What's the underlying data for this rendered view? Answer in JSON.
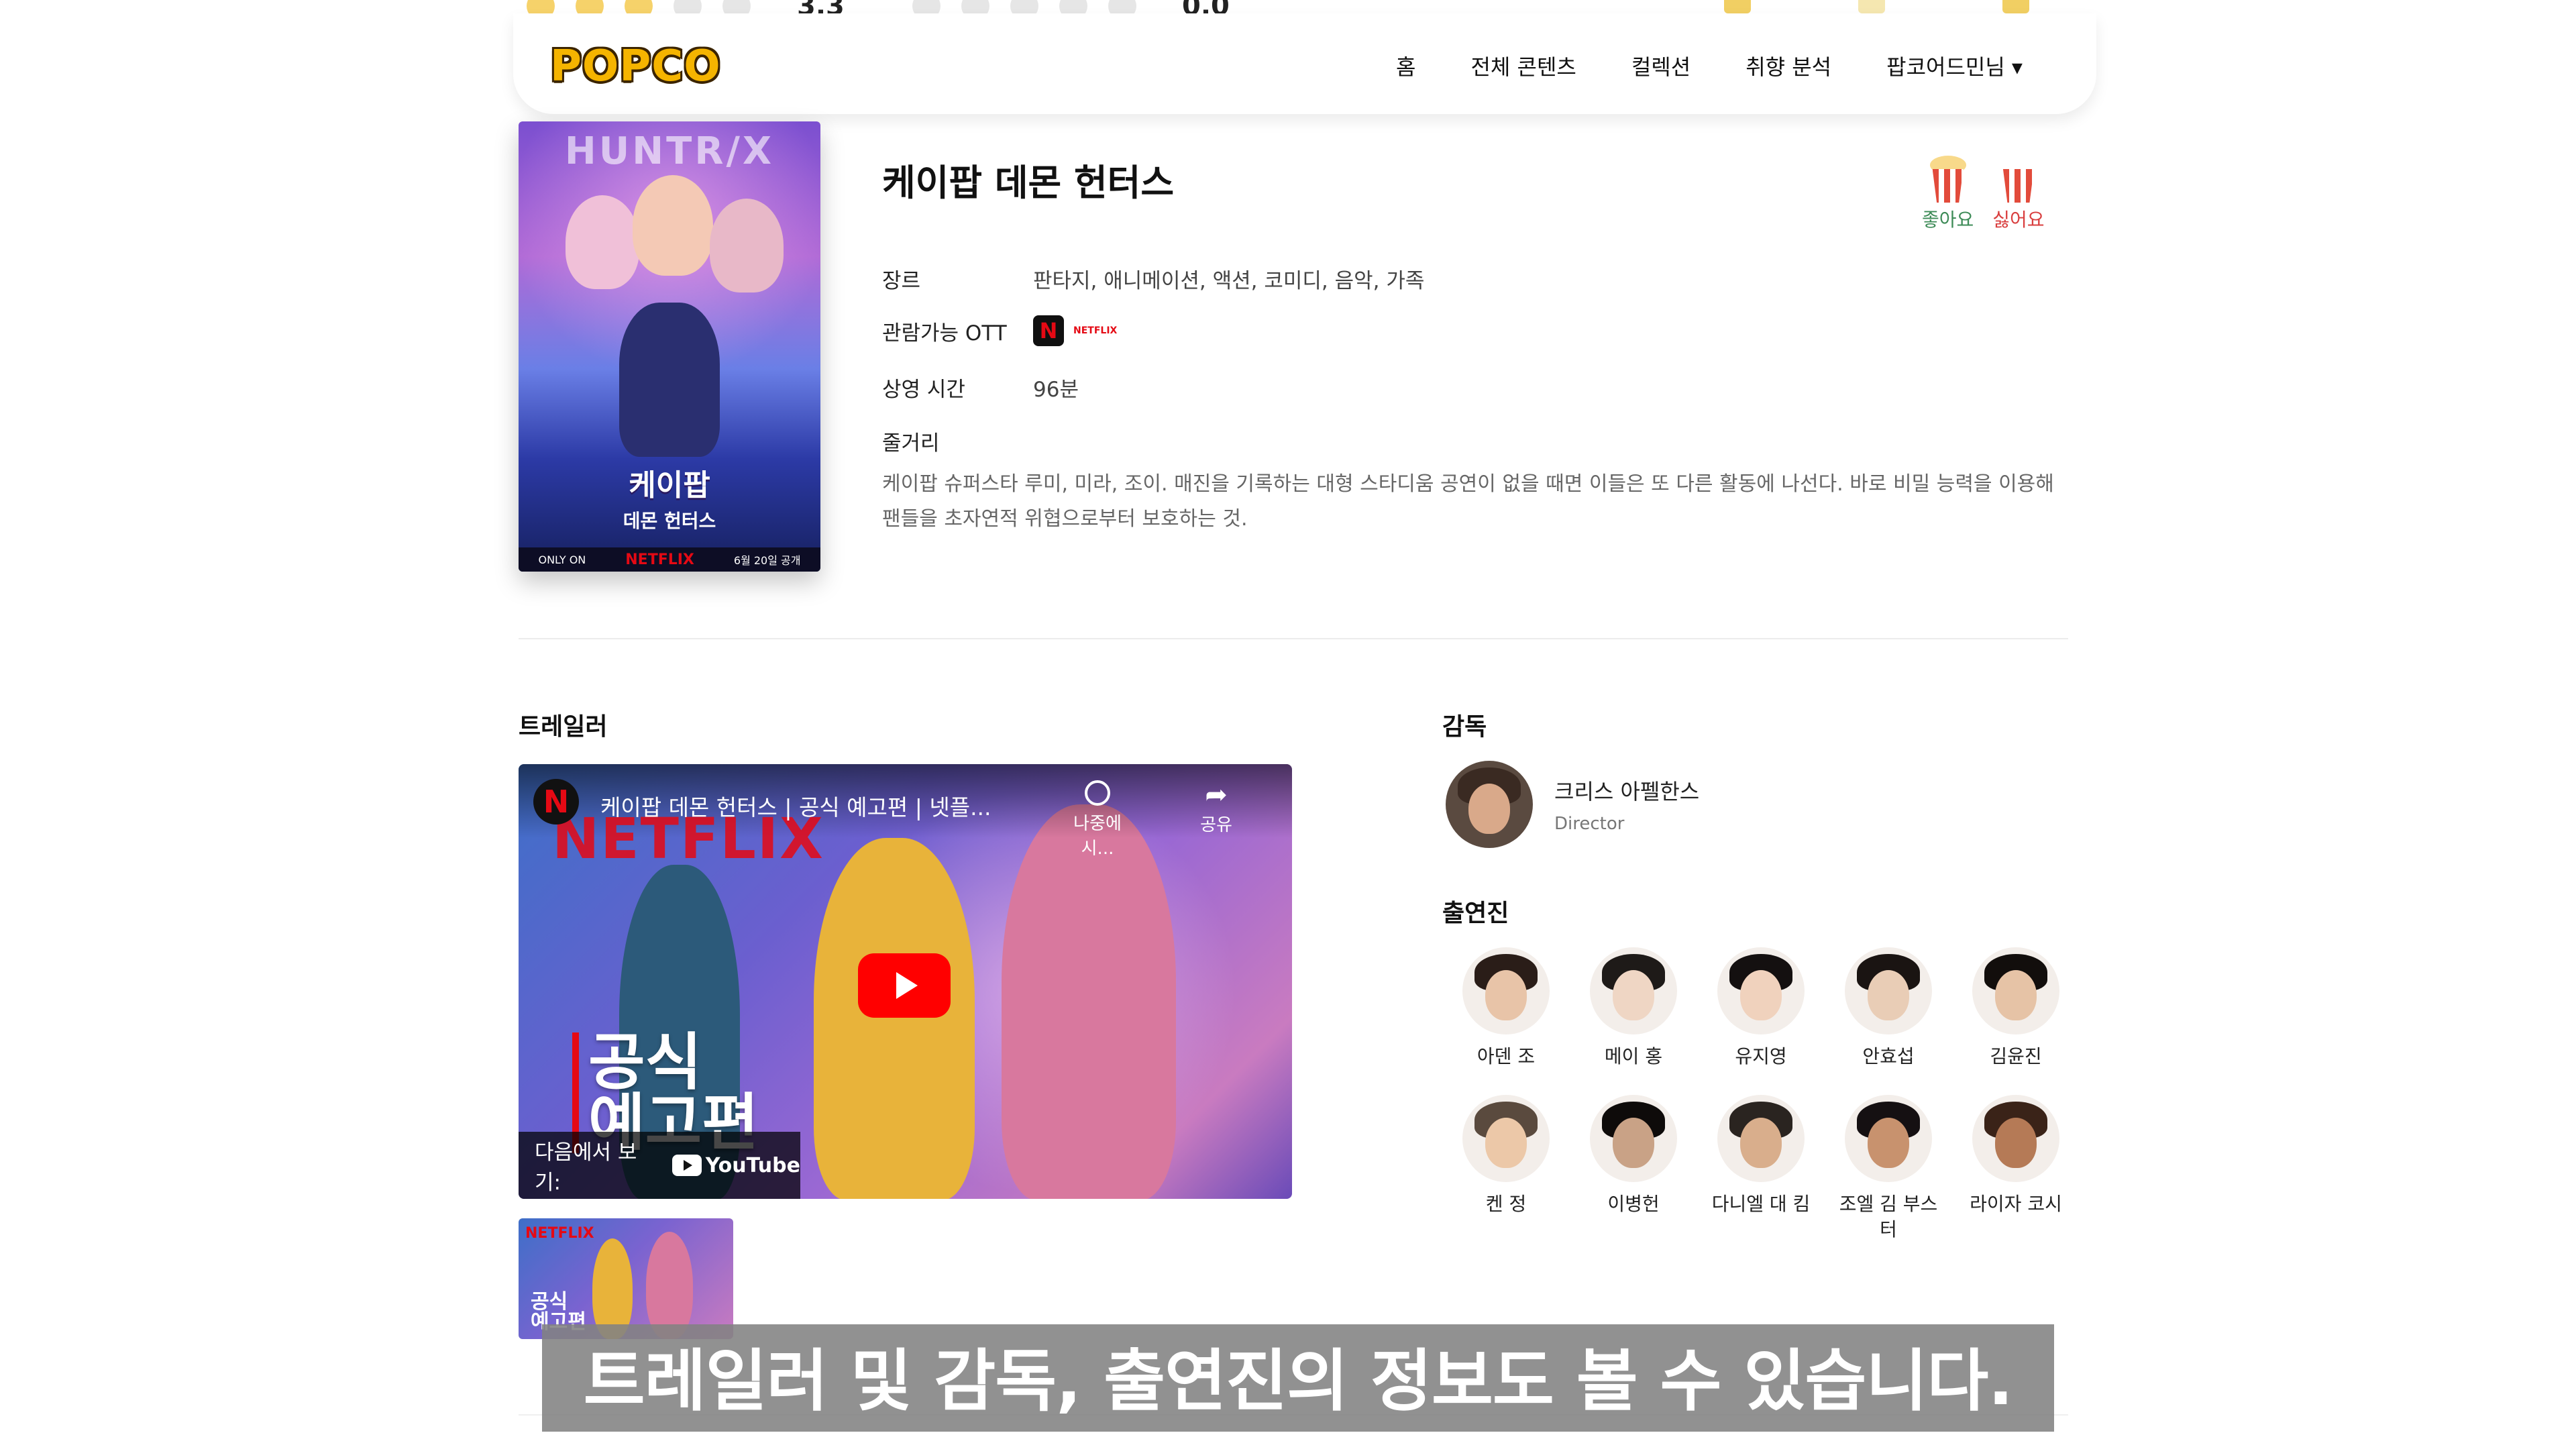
{
  "rating_strip": {
    "left_score": "3.3",
    "left_stars_filled": 3,
    "right_score": "0.0",
    "right_stars_filled": 0
  },
  "header": {
    "logo": "POPCO",
    "nav": [
      "홈",
      "전체 콘텐츠",
      "컬렉션",
      "취향 분석",
      "팝코어드민님 ▾"
    ]
  },
  "movie": {
    "title": "케이팝 데몬 헌터스",
    "poster_title": "케이팝",
    "poster_subtitle": "데몬 헌터스",
    "poster_top_text": "HUNTR/X",
    "poster_footer_left": "ONLY ON",
    "poster_footer_brand": "NETFLIX",
    "poster_footer_right": "6월 20일 공개",
    "reactions": {
      "like": "좋아요",
      "dislike": "싫어요"
    },
    "genre_label": "장르",
    "genre": "판타지, 애니메이션, 액션, 코미디, 음악, 가족",
    "ott_label": "관람가능 OTT",
    "ott_badge": "N",
    "ott_name": "NETFLIX",
    "runtime_label": "상영 시간",
    "runtime": "96분",
    "synopsis_label": "줄거리",
    "synopsis": "케이팝 슈퍼스타 루미, 미라, 조이. 매진을 기록하는 대형 스타디움 공연이 없을 때면 이들은 또 다른 활동에 나선다. 바로 비밀 능력을 이용해 팬들을 초자연적 위협으로부터 보호하는 것."
  },
  "trailer": {
    "section_title": "트레일러",
    "video_title": "케이팝 데몬 헌터스 | 공식 예고편 | 넷플...",
    "channel_badge": "N",
    "brand_text": "NETFLIX",
    "watch_later": "나중에 시...",
    "share": "공유",
    "promo_text": "공식\n예고편",
    "watch_on": "다음에서 보기:",
    "youtube": "YouTube",
    "thumb_brand": "NETFLIX",
    "thumb_text": "공식\n예고편"
  },
  "director": {
    "section_title": "감독",
    "name": "크리스 아펠한스",
    "role": "Director"
  },
  "cast": {
    "section_title": "출연진",
    "members": [
      {
        "name": "아덴 조",
        "skin": "#e8c4a8",
        "hair": "#2a1d18"
      },
      {
        "name": "메이 홍",
        "skin": "#efd6c4",
        "hair": "#1e1a18"
      },
      {
        "name": "유지영",
        "skin": "#f0d2bd",
        "hair": "#141010"
      },
      {
        "name": "안효섭",
        "skin": "#e9cdb6",
        "hair": "#1a1412"
      },
      {
        "name": "김윤진",
        "skin": "#e6c3a6",
        "hair": "#120e0c"
      },
      {
        "name": "켄 정",
        "skin": "#ecc8a8",
        "hair": "#5a4a3e"
      },
      {
        "name": "이병헌",
        "skin": "#c9a286",
        "hair": "#0e0b0a"
      },
      {
        "name": "다니엘 대 킴",
        "skin": "#d9ae8c",
        "hair": "#2a2420"
      },
      {
        "name": "조엘 김 부스터",
        "skin": "#c8926e",
        "hair": "#151012"
      },
      {
        "name": "라이자 코시",
        "skin": "#b57a56",
        "hair": "#3a2318"
      }
    ]
  },
  "caption": "트레일러 및 감독, 출연진의 정보도 볼 수 있습니다.",
  "colors": {
    "accent_yellow": "#f5b400",
    "netflix_red": "#e50914",
    "like_green": "#3d8b57",
    "dislike_red": "#d93f3f",
    "youtube_red": "#ff0000"
  }
}
